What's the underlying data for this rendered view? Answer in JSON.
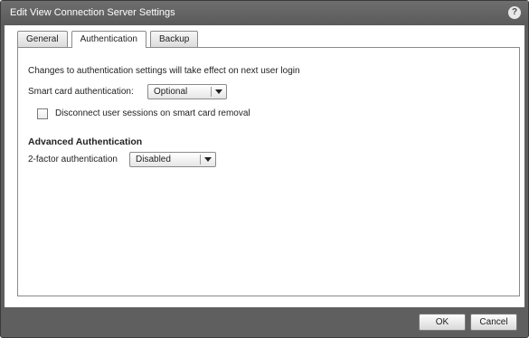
{
  "window": {
    "title": "Edit View Connection Server Settings",
    "help_label": "?"
  },
  "tabs": [
    {
      "label": "General",
      "active": false
    },
    {
      "label": "Authentication",
      "active": true
    },
    {
      "label": "Backup",
      "active": false
    }
  ],
  "authentication": {
    "note": "Changes to authentication settings will take effect on next user login",
    "smart_card_label": "Smart card authentication:",
    "smart_card_value": "Optional",
    "disconnect_checkbox_label": "Disconnect user sessions on smart card removal",
    "disconnect_checked": false,
    "advanced_heading": "Advanced Authentication",
    "two_factor_label": "2-factor authentication",
    "two_factor_value": "Disabled"
  },
  "footer": {
    "ok_label": "OK",
    "cancel_label": "Cancel"
  },
  "colors": {
    "titlebar": "#5f5f5f",
    "panel_bg": "#ffffff",
    "border": "#8a8a8a"
  }
}
